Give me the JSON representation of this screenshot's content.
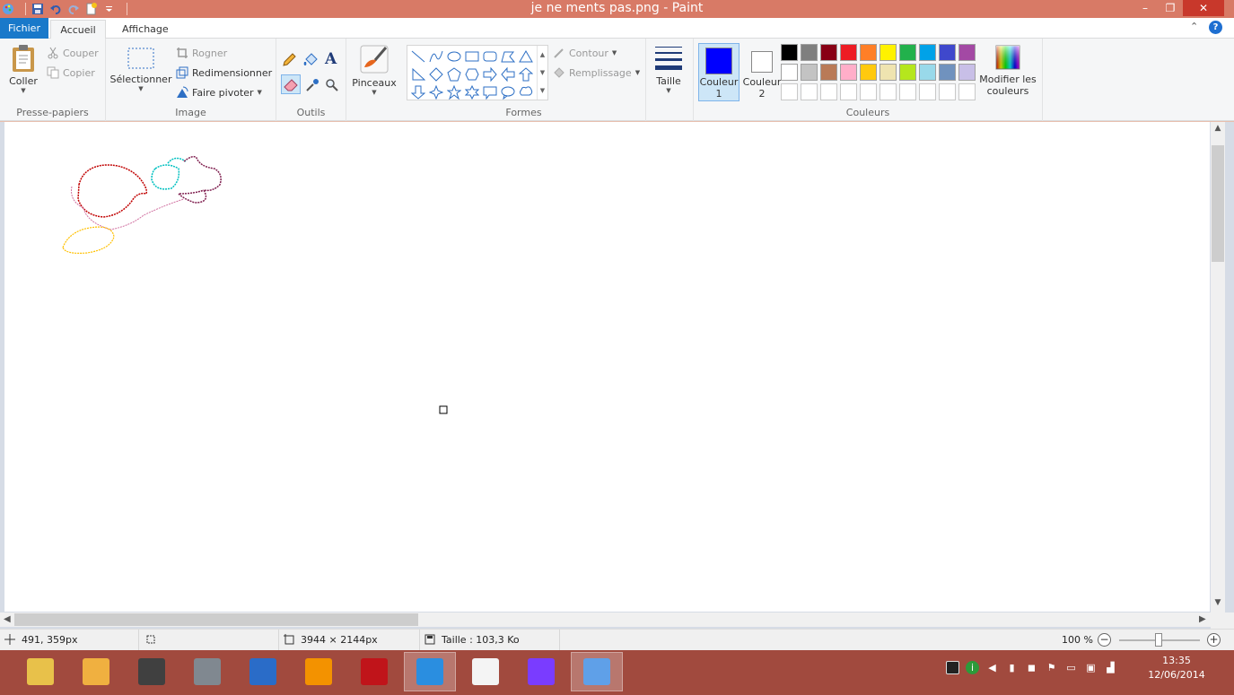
{
  "window": {
    "title": "je ne ments pas.png - Paint",
    "minimize": "–",
    "maximize": "❐",
    "close": "✕"
  },
  "tabs": {
    "file": "Fichier",
    "home": "Accueil",
    "view": "Affichage"
  },
  "ribbon": {
    "clipboard": {
      "paste": "Coller",
      "cut": "Couper",
      "copy": "Copier",
      "label": "Presse-papiers"
    },
    "image": {
      "select": "Sélectionner",
      "crop": "Rogner",
      "resize": "Redimensionner",
      "rotate": "Faire pivoter",
      "label": "Image"
    },
    "tools": {
      "label": "Outils",
      "text_tool": "A"
    },
    "brushes": {
      "label": "Pinceaux"
    },
    "shapes": {
      "outline": "Contour",
      "fill": "Remplissage",
      "label": "Formes"
    },
    "size": {
      "label": "Taille"
    },
    "colors": {
      "color1_line1": "Couleur",
      "color1_line2": "1",
      "color2_line1": "Couleur",
      "color2_line2": "2",
      "edit_line1": "Modifier les",
      "edit_line2": "couleurs",
      "label": "Couleurs",
      "color1_value": "#0000ff",
      "color2_value": "#ffffff",
      "palette": [
        "#000000",
        "#7f7f7f",
        "#880015",
        "#ed1c24",
        "#ff7f27",
        "#fff200",
        "#22b14c",
        "#00a2e8",
        "#3f48cc",
        "#a349a4",
        "#ffffff",
        "#c3c3c3",
        "#b97a57",
        "#ffaec9",
        "#ffc90e",
        "#efe4b0",
        "#b5e61d",
        "#99d9ea",
        "#7092be",
        "#c8bfe7",
        "#ffffff",
        "#ffffff",
        "#ffffff",
        "#ffffff",
        "#ffffff",
        "#ffffff",
        "#ffffff",
        "#ffffff",
        "#ffffff",
        "#ffffff"
      ]
    }
  },
  "canvas": {
    "stroke_colors": {
      "red": "#c00000",
      "cyan": "#00c0c0",
      "purple": "#7f1f4f",
      "pink": "#d070a0",
      "yellow": "#ffc000"
    }
  },
  "status": {
    "cursor_pos": "491, 359px",
    "image_size": "3944 × 2144px",
    "file_size": "Taille : 103,3 Ko",
    "zoom": "100 %"
  },
  "taskbar": {
    "apps": [
      {
        "name": "explorer",
        "color": "#e8c14a"
      },
      {
        "name": "app-2",
        "color": "#f0b040"
      },
      {
        "name": "speaker",
        "color": "#404040"
      },
      {
        "name": "doc-app",
        "color": "#808890"
      },
      {
        "name": "settings",
        "color": "#2a6cc8"
      },
      {
        "name": "vlc",
        "color": "#f39200"
      },
      {
        "name": "power",
        "color": "#c0141a"
      },
      {
        "name": "internet-explorer",
        "color": "#2a8ee0"
      },
      {
        "name": "file",
        "color": "#f4f4f4"
      },
      {
        "name": "video",
        "color": "#7a3cff"
      },
      {
        "name": "paint",
        "color": "#5fa0e8"
      }
    ],
    "time": "13:35",
    "date": "12/06/2014"
  }
}
